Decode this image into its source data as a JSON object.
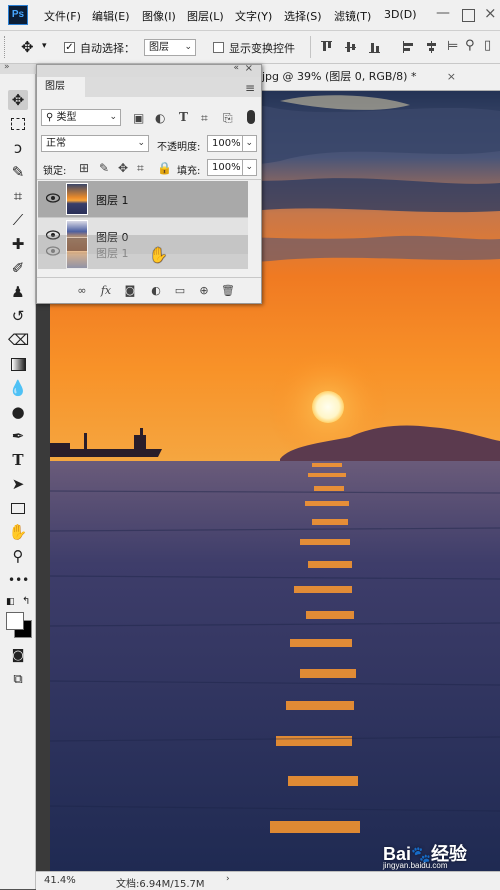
{
  "app": {
    "logo": "Ps"
  },
  "menubar": {
    "items": [
      "文件(F)",
      "编辑(E)",
      "图像(I)",
      "图层(L)",
      "文字(Y)",
      "选择(S)",
      "滤镜(T)",
      "3D(D)"
    ]
  },
  "options_bar": {
    "auto_select_label": "自动选择：",
    "auto_select_checked": true,
    "auto_select_target": "图层",
    "show_transform_label": "显示变换控件",
    "show_transform_checked": false
  },
  "document": {
    "tab_title": "jpg @ 39% (图层 0, RGB/8) *"
  },
  "layers_panel": {
    "tab": "图层",
    "filter_kind": "类型",
    "blend_mode": "正常",
    "opacity_label": "不透明度:",
    "opacity_value": "100%",
    "lock_label": "锁定:",
    "fill_label": "填充:",
    "fill_value": "100%",
    "layers": [
      {
        "name": "图层 1",
        "selected": true
      },
      {
        "name": "图层 0",
        "selected": false
      }
    ],
    "drag_ghost_name": "图层 1"
  },
  "status_bar": {
    "zoom": "41.4%",
    "doc_size": "文档:6.94M/15.7M"
  },
  "watermark": {
    "brand": "Bai",
    "brand2": "经验",
    "url": "jingyan.baidu.com"
  },
  "colors": {
    "ui_light": "#f0f0f0",
    "selection": "#a9a9a9",
    "sky_top": "#2b3a5c",
    "sunset": "#f28a1a",
    "sea": "#2d3566"
  },
  "icons": [
    "move-icon",
    "marquee-icon",
    "lasso-icon",
    "quick-select-icon",
    "crop-icon",
    "eyedropper-icon",
    "healing-icon",
    "brush-icon",
    "stamp-icon",
    "history-brush-icon",
    "eraser-icon",
    "gradient-icon",
    "blur-icon",
    "dodge-icon",
    "pen-icon",
    "type-icon",
    "path-select-icon",
    "rectangle-icon",
    "hand-icon",
    "zoom-icon",
    "more-icon",
    "swap-colors-icon",
    "quick-mask-icon",
    "screen-mode-icon",
    "eye-icon",
    "hand-cursor-icon"
  ]
}
